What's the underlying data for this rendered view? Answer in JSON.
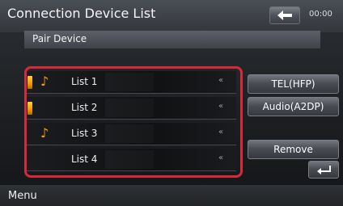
{
  "header": {
    "title": "Connection Device List",
    "clock": "00:00",
    "back_icon": "back-arrow-icon"
  },
  "subheader": {
    "title": "Pair Device"
  },
  "list": {
    "items": [
      {
        "label": "List 1",
        "tel": true,
        "audio": true
      },
      {
        "label": "List 2",
        "tel": true,
        "audio": false
      },
      {
        "label": "List 3",
        "tel": false,
        "audio": true
      },
      {
        "label": "List 4",
        "tel": false,
        "audio": false
      }
    ],
    "arrow_glyph": "«",
    "note_glyph": "♪"
  },
  "buttons": {
    "tel": "TEL(HFP)",
    "audio": "Audio(A2DP)",
    "remove": "Remove"
  },
  "footer": {
    "menu": "Menu"
  },
  "colors": {
    "highlight": "#d8283c",
    "icon_orange": "#f2a014"
  }
}
